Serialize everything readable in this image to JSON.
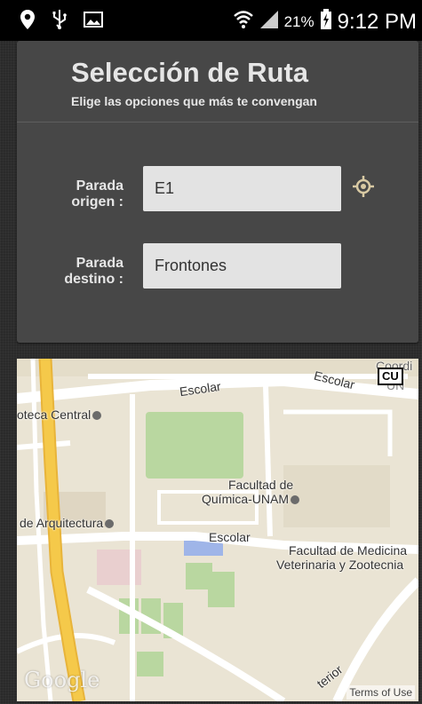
{
  "status_bar": {
    "battery_percent": "21%",
    "time": "9:12 PM",
    "icons": [
      "location-icon",
      "usb-icon",
      "image-icon",
      "wifi-icon",
      "signal-icon",
      "battery-charging-icon"
    ]
  },
  "card": {
    "title": "Selección de Ruta",
    "subtitle": "Elige las opciones que más te convengan",
    "origin_label": "Parada\norigen :",
    "origin_value": "E1",
    "destination_label": "Parada\ndestino :",
    "destination_value": "Frontones",
    "locate_icon": "crosshair-icon"
  },
  "map": {
    "badge": "CU",
    "labels": {
      "escolar_1": "Escolar",
      "escolar_2": "Escolar",
      "escolar_3": "Escolar",
      "biblioteca": "oteca Central",
      "quimica_1": "Facultad de",
      "quimica_2": "Química-UNAM",
      "arquitectura": "de Arquitectura",
      "medicina_1": "Facultad de Medicina",
      "medicina_2": "Veterinaria y Zootecnia",
      "un": "UN",
      "cu_top": "Coordi",
      "terior": "terior"
    },
    "google": "Google",
    "terms": "Terms of Use"
  },
  "colors": {
    "card_bg": "#474747",
    "input_bg": "#e3e3e3",
    "locate_accent": "#d8c9a3",
    "map_bg": "#eae4d4",
    "road_yellow": "#f5c94a",
    "park_green": "#b9d7a0"
  }
}
